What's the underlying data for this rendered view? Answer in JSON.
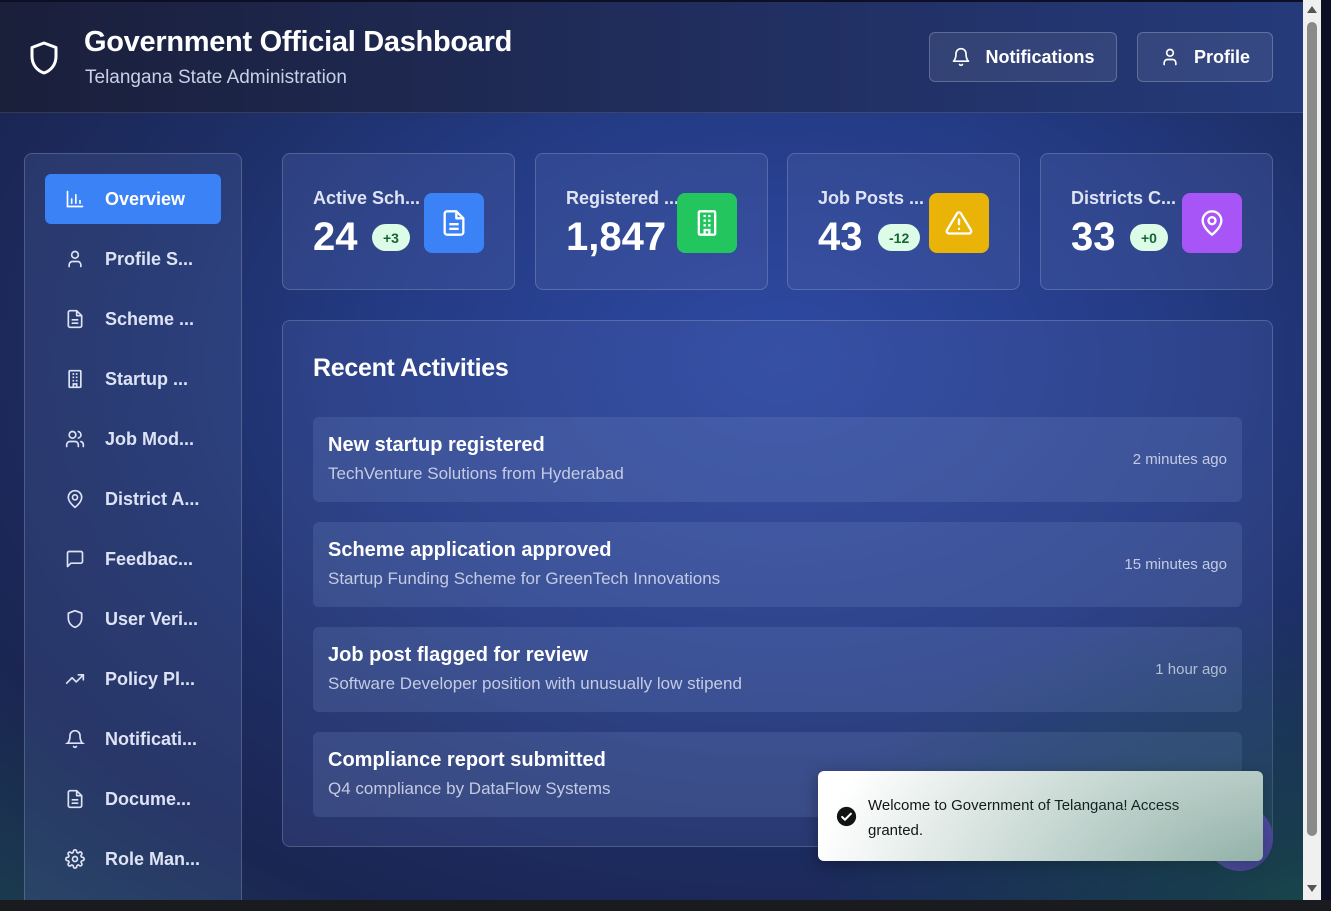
{
  "header": {
    "title": "Government Official Dashboard",
    "subtitle": "Telangana State Administration",
    "notifications_label": "Notifications",
    "profile_label": "Profile"
  },
  "sidebar": {
    "items": [
      {
        "label": "Overview",
        "icon": "bar-chart-icon",
        "active": true
      },
      {
        "label": "Profile S...",
        "icon": "user-icon"
      },
      {
        "label": "Scheme ...",
        "icon": "document-icon"
      },
      {
        "label": "Startup ...",
        "icon": "building-icon"
      },
      {
        "label": "Job Mod...",
        "icon": "users-icon"
      },
      {
        "label": "District A...",
        "icon": "map-pin-icon"
      },
      {
        "label": "Feedbac...",
        "icon": "message-icon"
      },
      {
        "label": "User Veri...",
        "icon": "shield-icon"
      },
      {
        "label": "Policy Pl...",
        "icon": "trending-up-icon"
      },
      {
        "label": "Notificati...",
        "icon": "bell-icon"
      },
      {
        "label": "Docume...",
        "icon": "document-icon"
      },
      {
        "label": "Role Man...",
        "icon": "gear-icon"
      }
    ]
  },
  "stats": [
    {
      "label": "Active Sch...",
      "value": "24",
      "badge": "+3",
      "icon": "document-icon",
      "color": "#3b82f6"
    },
    {
      "label": "Registered ...",
      "value": "1,847",
      "badge": "+",
      "icon": "building-icon",
      "color": "#22c55e"
    },
    {
      "label": "Job Posts ...",
      "value": "43",
      "badge": "-12",
      "icon": "warning-icon",
      "color": "#eab308"
    },
    {
      "label": "Districts C...",
      "value": "33",
      "badge": "+0",
      "icon": "map-pin-icon",
      "color": "#a855f7"
    }
  ],
  "activities": {
    "title": "Recent Activities",
    "items": [
      {
        "title": "New startup registered",
        "desc": "TechVenture Solutions from Hyderabad",
        "time": "2 minutes ago"
      },
      {
        "title": "Scheme application approved",
        "desc": "Startup Funding Scheme for GreenTech Innovations",
        "time": "15 minutes ago"
      },
      {
        "title": "Job post flagged for review",
        "desc": "Software Developer position with unusually low stipend",
        "time": "1 hour ago"
      },
      {
        "title": "Compliance report submitted",
        "desc": "Q4 compliance by DataFlow Systems",
        "time": ""
      }
    ]
  },
  "toast": {
    "message": "Welcome to Government of Telangana! Access granted."
  }
}
